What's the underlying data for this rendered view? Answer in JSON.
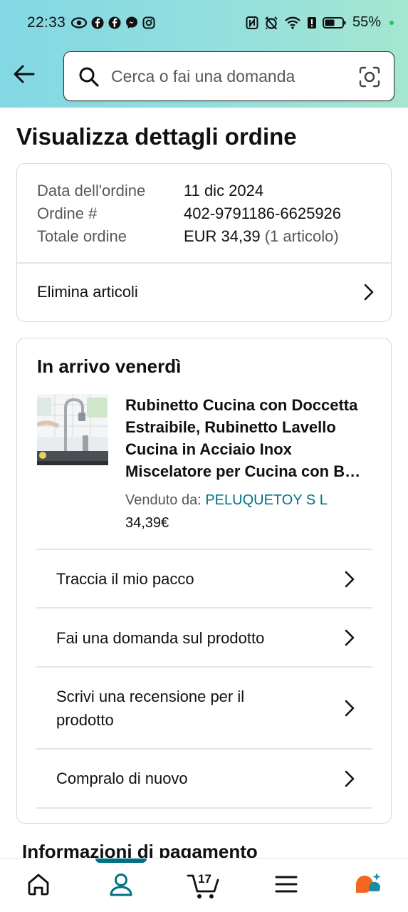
{
  "status_bar": {
    "time": "22:33",
    "battery": "55%",
    "left_icons": [
      "eye-icon",
      "facebook-icon",
      "facebook-icon",
      "messenger-icon",
      "instagram-icon"
    ],
    "right_icons": [
      "nfc-icon",
      "alarm-icon",
      "wifi-icon",
      "alert-icon",
      "battery-icon"
    ]
  },
  "search": {
    "placeholder": "Cerca o fai una domanda"
  },
  "page": {
    "title": "Visualizza dettagli ordine"
  },
  "order": {
    "date_label": "Data dell'ordine",
    "date_value": "11 dic 2024",
    "number_label": "Ordine #",
    "number_value": "402-9791186-6625926",
    "total_label": "Totale ordine",
    "total_value": "EUR 34,39",
    "total_items": "(1 articolo)",
    "delete_items_label": "Elimina articoli"
  },
  "shipment": {
    "title": "In arrivo venerdì",
    "product_title": "Rubinetto Cucina con Doccetta Estraibile, Rubinetto Lavello Cucina in Acciaio Inox Miscelatore per Cucina con B…",
    "sold_by_label": "Venduto da:",
    "seller": "PELUQUETOY S L",
    "price": "34,39€",
    "actions": [
      "Traccia il mio pacco",
      "Fai una domanda sul prodotto",
      "Scrivi una recensione per il prodotto",
      "Compralo di nuovo"
    ]
  },
  "payment": {
    "title": "Informazioni di pagamento"
  },
  "bottom_nav": {
    "items": [
      "home-icon",
      "account-icon",
      "cart-icon",
      "menu-icon",
      "rufus-icon"
    ],
    "active": "account-icon",
    "cart_count": "17"
  },
  "colors": {
    "accent": "#007185",
    "header_start": "#82d8e3",
    "header_end": "#a5e6cf",
    "rufus": "#f2661f"
  }
}
